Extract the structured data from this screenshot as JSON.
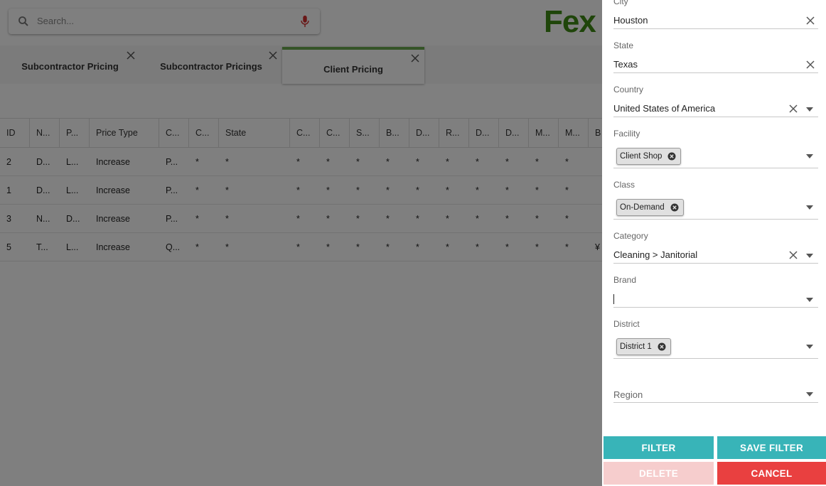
{
  "search": {
    "placeholder": "Search..."
  },
  "logo": {
    "text": "Fex"
  },
  "tabs": [
    {
      "label": "Subcontractor Pricing"
    },
    {
      "label": "Subcontractor Pricings"
    },
    {
      "label": "Client Pricing"
    }
  ],
  "grid": {
    "headers": [
      "ID",
      "N...",
      "P...",
      "Price Type",
      "C...",
      "C...",
      "State",
      "C...",
      "C...",
      "S...",
      "B...",
      "D...",
      "R...",
      "D...",
      "D...",
      "M...",
      "M...",
      "B"
    ],
    "rows": [
      [
        "2",
        "D...",
        "L...",
        "Increase",
        "P...",
        "*",
        "*",
        "*",
        "*",
        "*",
        "*",
        "*",
        "*",
        "*",
        "*",
        "*",
        "*",
        ""
      ],
      [
        "1",
        "D...",
        "L...",
        "Increase",
        "P...",
        "*",
        "*",
        "*",
        "*",
        "*",
        "*",
        "*",
        "*",
        "*",
        "*",
        "*",
        "*",
        ""
      ],
      [
        "3",
        "N...",
        "D...",
        "Increase",
        "P...",
        "*",
        "*",
        "*",
        "*",
        "*",
        "*",
        "*",
        "*",
        "*",
        "*",
        "*",
        "*",
        ""
      ],
      [
        "5",
        "T...",
        "L...",
        "Increase",
        "Q...",
        "*",
        "*",
        "*",
        "*",
        "*",
        "*",
        "*",
        "*",
        "*",
        "*",
        "*",
        "*",
        "¥"
      ]
    ]
  },
  "filter": {
    "city": {
      "label": "City",
      "value": "Houston"
    },
    "state": {
      "label": "State",
      "value": "Texas"
    },
    "country": {
      "label": "Country",
      "value": "United States of America"
    },
    "facility": {
      "label": "Facility",
      "chips": [
        "Client Shop"
      ]
    },
    "class": {
      "label": "Class",
      "chips": [
        "On-Demand"
      ]
    },
    "category": {
      "label": "Category",
      "value": "Cleaning > Janitorial"
    },
    "brand": {
      "label": "Brand",
      "value": ""
    },
    "district": {
      "label": "District",
      "chips": [
        "District 1"
      ]
    },
    "region": {
      "label": "Region",
      "placeholder": "Region"
    }
  },
  "buttons": {
    "filter": "FILTER",
    "save_filter": "SAVE FILTER",
    "delete": "DELETE",
    "cancel": "CANCEL"
  },
  "colors": {
    "accent_teal": "#38b4b8",
    "cancel_red": "#e94040",
    "delete_disabled": "#f6cdcd",
    "active_tab": "#6aa84f",
    "mic_red": "#d32f2f"
  }
}
